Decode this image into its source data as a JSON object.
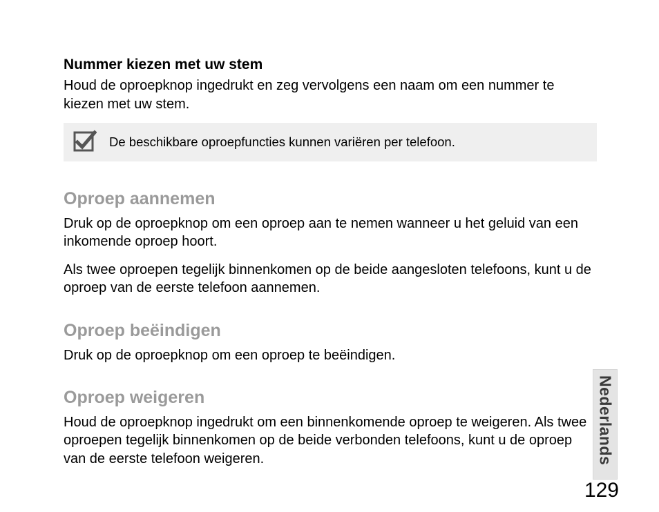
{
  "section1": {
    "title": "Nummer kiezen met uw stem",
    "body": "Houd de oproepknop ingedrukt en zeg vervolgens een naam om een nummer te kiezen met uw stem."
  },
  "note": {
    "text": "De beschikbare oproepfuncties kunnen variëren per telefoon."
  },
  "section2": {
    "title": "Oproep aannemen",
    "body1": "Druk op de oproepknop om een oproep aan te nemen wanneer u het geluid van een inkomende oproep hoort.",
    "body2": "Als twee oproepen tegelijk binnenkomen op de beide aangesloten telefoons, kunt u de oproep van de eerste telefoon aannemen."
  },
  "section3": {
    "title": "Oproep beëindigen",
    "body": "Druk op de oproepknop om een oproep te beëindigen."
  },
  "section4": {
    "title": "Oproep weigeren",
    "body": "Houd de oproepknop ingedrukt om een binnenkomende oproep te weigeren. Als twee oproepen tegelijk binnenkomen op de beide verbonden telefoons, kunt u de oproep van de eerste telefoon weigeren."
  },
  "sideTab": "Nederlands",
  "pageNumber": "129"
}
